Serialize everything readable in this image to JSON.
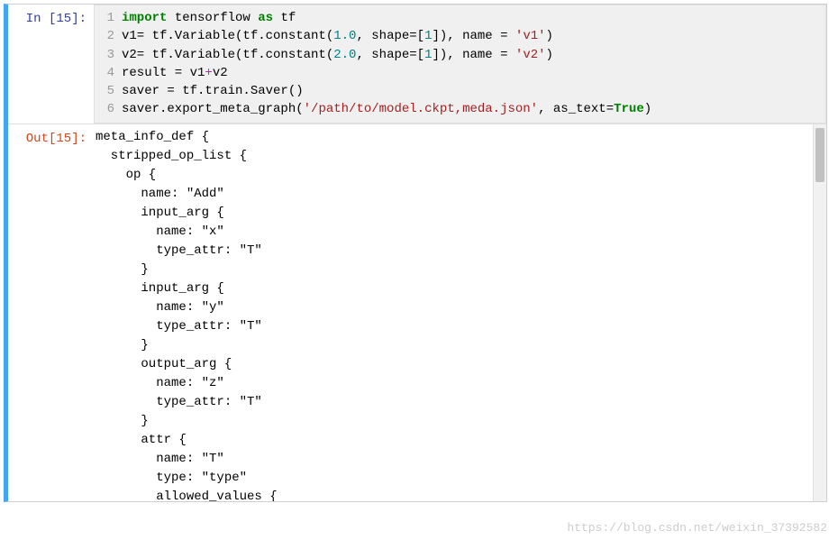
{
  "input_prompt": "In  [15]:",
  "output_prompt": "Out[15]:",
  "code_lines": [
    {
      "n": "1",
      "html": "<span class='kw-green'>import</span> tensorflow <span class='kw-green'>as</span> tf"
    },
    {
      "n": "2",
      "html": "v1= tf.Variable(tf.constant(<span class='num'>1.0</span>, shape=[<span class='num'>1</span>]), name = <span class='str'>'v1'</span>)"
    },
    {
      "n": "3",
      "html": "v2= tf.Variable(tf.constant(<span class='num'>2.0</span>, shape=[<span class='num'>1</span>]), name = <span class='str'>'v2'</span>)"
    },
    {
      "n": "4",
      "html": "result = v1<span class='op'>+</span>v2"
    },
    {
      "n": "5",
      "html": "saver = tf.train.Saver()"
    },
    {
      "n": "6",
      "html": "saver.export_meta_graph(<span class='str'>'/path/to/model.ckpt,meda.json'</span>, as_text=<span class='true'>True</span>)"
    }
  ],
  "output_text": "meta_info_def {\n  stripped_op_list {\n    op {\n      name: \"Add\"\n      input_arg {\n        name: \"x\"\n        type_attr: \"T\"\n      }\n      input_arg {\n        name: \"y\"\n        type_attr: \"T\"\n      }\n      output_arg {\n        name: \"z\"\n        type_attr: \"T\"\n      }\n      attr {\n        name: \"T\"\n        type: \"type\"\n        allowed_values {",
  "watermark": "https://blog.csdn.net/weixin_37392582"
}
